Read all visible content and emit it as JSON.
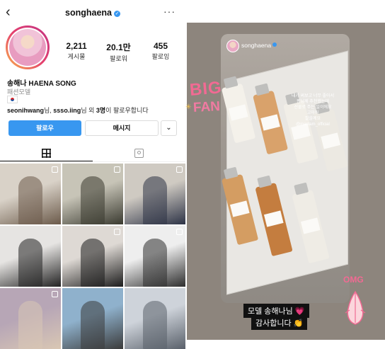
{
  "profile": {
    "username": "songhaena",
    "stats": [
      {
        "value": "2,211",
        "label": "게시물"
      },
      {
        "value": "20.1만",
        "label": "팔로워"
      },
      {
        "value": "455",
        "label": "팔로잉"
      }
    ],
    "full_name": "송해나 HAENA SONG",
    "category": "패션모델",
    "followed_by": {
      "names": "seonihwang",
      "mid": "님, ",
      "name2": "ssso.iing",
      "rest": "님 외 ",
      "count": "3명",
      "tail": "이 팔로우합니다"
    },
    "follow_label": "팔로우",
    "message_label": "메시지",
    "colors": {
      "accent": "#3897f0"
    }
  },
  "grid": [
    {
      "bg": "#d9d2c8",
      "fg": "#6b5a4a",
      "multi": true
    },
    {
      "bg": "#c7c4b7",
      "fg": "#3a3a30",
      "multi": true
    },
    {
      "bg": "#cfcac2",
      "fg": "#2d3346",
      "multi": true
    },
    {
      "bg": "#e6e4e2",
      "fg": "#222222",
      "multi": false
    },
    {
      "bg": "#ded9d4",
      "fg": "#1c1c1c",
      "multi": true
    },
    {
      "bg": "#eeeeee",
      "fg": "#2e2e2e",
      "multi": true
    },
    {
      "bg": "#b7a6b6",
      "fg": "#d9c7b4",
      "multi": true
    },
    {
      "bg": "#8fb1cc",
      "fg": "#3b3b3b",
      "multi": false
    },
    {
      "bg": "#ced3da",
      "fg": "#59606a",
      "multi": false
    }
  ],
  "story": {
    "username": "songhaena",
    "text_lines": [
      "내가 써보고 너무 좋아서",
      "팬님께 추천했는데",
      "선물로 주는 일이에요",
      "고마워",
      "잘쓸께요",
      "@mastam_official"
    ],
    "sticker_big": "BIG",
    "sticker_fan": "FAN",
    "sticker_omg": "OMG",
    "caption_1": "모델 송해나님 💗",
    "caption_2": "감사합니다 👏"
  }
}
